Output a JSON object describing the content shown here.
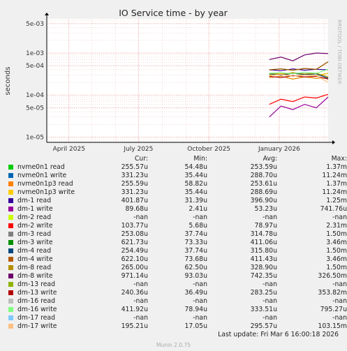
{
  "title": "IO Service time - by year",
  "watermark": "RRDTOOL / TOBI OETIKER",
  "footer": {
    "last_update": "Last update: Fri Mar  6 16:00:18 2026",
    "version": "Munin 2.0.75"
  },
  "legend_headers": {
    "cur": "Cur:",
    "min": "Min:",
    "avg": "Avg:",
    "max": "Max:"
  },
  "legend": [
    {
      "name": "nvme0n1 read",
      "color": "#00cc00",
      "cur": "255.57u",
      "min": "54.48u",
      "avg": "253.59u",
      "max": "1.37m"
    },
    {
      "name": "nvme0n1 write",
      "color": "#0066b3",
      "cur": "331.23u",
      "min": "35.44u",
      "avg": "288.70u",
      "max": "11.24m"
    },
    {
      "name": "nvme0n1p3 read",
      "color": "#ff8000",
      "cur": "255.59u",
      "min": "58.82u",
      "avg": "253.61u",
      "max": "1.37m"
    },
    {
      "name": "nvme0n1p3 write",
      "color": "#ffcc00",
      "cur": "331.23u",
      "min": "35.44u",
      "avg": "288.69u",
      "max": "11.24m"
    },
    {
      "name": "dm-1 read",
      "color": "#330099",
      "cur": "401.87u",
      "min": "31.39u",
      "avg": "396.90u",
      "max": "1.25m"
    },
    {
      "name": "dm-1 write",
      "color": "#990099",
      "cur": "89.68u",
      "min": "2.41u",
      "avg": "53.23u",
      "max": "741.76u"
    },
    {
      "name": "dm-2 read",
      "color": "#ccff00",
      "cur": "-nan",
      "min": "-nan",
      "avg": "-nan",
      "max": "-nan"
    },
    {
      "name": "dm-2 write",
      "color": "#ff0000",
      "cur": "103.77u",
      "min": "5.68u",
      "avg": "78.97u",
      "max": "2.31m"
    },
    {
      "name": "dm-3 read",
      "color": "#808080",
      "cur": "253.08u",
      "min": "37.74u",
      "avg": "314.78u",
      "max": "1.50m"
    },
    {
      "name": "dm-3 write",
      "color": "#008f00",
      "cur": "621.73u",
      "min": "73.33u",
      "avg": "411.06u",
      "max": "3.46m"
    },
    {
      "name": "dm-4 read",
      "color": "#00487d",
      "cur": "254.49u",
      "min": "37.74u",
      "avg": "315.80u",
      "max": "1.50m"
    },
    {
      "name": "dm-4 write",
      "color": "#b35a00",
      "cur": "622.10u",
      "min": "73.68u",
      "avg": "411.43u",
      "max": "3.46m"
    },
    {
      "name": "dm-8 read",
      "color": "#b38f00",
      "cur": "265.00u",
      "min": "62.50u",
      "avg": "328.90u",
      "max": "1.50m"
    },
    {
      "name": "dm-8 write",
      "color": "#6b006b",
      "cur": "971.14u",
      "min": "93.03u",
      "avg": "742.35u",
      "max": "326.50m"
    },
    {
      "name": "dm-13 read",
      "color": "#8fb300",
      "cur": "-nan",
      "min": "-nan",
      "avg": "-nan",
      "max": "-nan"
    },
    {
      "name": "dm-13 write",
      "color": "#b30000",
      "cur": "240.36u",
      "min": "36.49u",
      "avg": "283.25u",
      "max": "353.82m"
    },
    {
      "name": "dm-16 read",
      "color": "#bebebe",
      "cur": "-nan",
      "min": "-nan",
      "avg": "-nan",
      "max": "-nan"
    },
    {
      "name": "dm-16 write",
      "color": "#80ff80",
      "cur": "411.92u",
      "min": "78.94u",
      "avg": "333.51u",
      "max": "795.27u"
    },
    {
      "name": "dm-17 read",
      "color": "#80c9ff",
      "cur": "-nan",
      "min": "-nan",
      "avg": "-nan",
      "max": "-nan"
    },
    {
      "name": "dm-17 write",
      "color": "#ffc080",
      "cur": "195.21u",
      "min": "17.05u",
      "avg": "295.57u",
      "max": "103.15m"
    }
  ],
  "chart_data": {
    "type": "line",
    "title": "IO Service time - by year",
    "ylabel": "seconds",
    "xlabel": "",
    "y_scale": "log",
    "ylim": [
      7.5e-06,
      0.0065
    ],
    "y_ticks": [
      {
        "value": 1e-05,
        "label": "1e-05"
      },
      {
        "value": 5e-05,
        "label": "5e-05"
      },
      {
        "value": 0.0001,
        "label": "1e-04"
      },
      {
        "value": 0.0005,
        "label": "5e-04"
      },
      {
        "value": 0.001,
        "label": "1e-03"
      },
      {
        "value": 0.005,
        "label": "5e-03"
      }
    ],
    "xlim": [
      "2025-03-03",
      "2026-03-06"
    ],
    "x_ticks": [
      {
        "value": "2025-04-01",
        "label": "April 2025"
      },
      {
        "value": "2025-07-01",
        "label": "July 2025"
      },
      {
        "value": "2025-10-01",
        "label": "October 2025"
      },
      {
        "value": "2026-01-01",
        "label": "January 2026"
      }
    ],
    "grid": true,
    "data_start": "2025-12-19",
    "series": [
      {
        "name": "nvme0n1 read",
        "color": "#00cc00",
        "values": [
          0.00026,
          0.00028,
          0.00024,
          0.00027,
          0.00025,
          0.00026
        ]
      },
      {
        "name": "nvme0n1 write",
        "color": "#0066b3",
        "values": [
          0.0003,
          0.00033,
          0.00028,
          0.00031,
          0.00029,
          0.00033
        ]
      },
      {
        "name": "nvme0n1p3 read",
        "color": "#ff8000",
        "values": [
          0.00026,
          0.00028,
          0.00024,
          0.00027,
          0.00025,
          0.00026
        ]
      },
      {
        "name": "nvme0n1p3 write",
        "color": "#ffcc00",
        "values": [
          0.0003,
          0.00033,
          0.00028,
          0.00031,
          0.00029,
          0.00033
        ]
      },
      {
        "name": "dm-1 read",
        "color": "#330099",
        "values": [
          0.0004,
          0.00038,
          0.00042,
          0.00039,
          0.00041,
          0.0004
        ]
      },
      {
        "name": "dm-1 write",
        "color": "#990099",
        "values": [
          3e-05,
          5.5e-05,
          4.5e-05,
          6e-05,
          5e-05,
          9e-05
        ]
      },
      {
        "name": "dm-2 write",
        "color": "#ff0000",
        "values": [
          6e-05,
          8e-05,
          7e-05,
          9e-05,
          8.5e-05,
          0.000104
        ]
      },
      {
        "name": "dm-3 read",
        "color": "#808080",
        "values": [
          0.00032,
          0.0003,
          0.00033,
          0.00031,
          0.00032,
          0.00025
        ]
      },
      {
        "name": "dm-3 write",
        "color": "#008f00",
        "values": [
          0.0004,
          0.00042,
          0.00039,
          0.00043,
          0.00041,
          0.00062
        ]
      },
      {
        "name": "dm-4 read",
        "color": "#00487d",
        "values": [
          0.00032,
          0.0003,
          0.00033,
          0.00031,
          0.00032,
          0.00025
        ]
      },
      {
        "name": "dm-4 write",
        "color": "#b35a00",
        "values": [
          0.0004,
          0.00042,
          0.00039,
          0.00043,
          0.00041,
          0.00062
        ]
      },
      {
        "name": "dm-8 read",
        "color": "#b38f00",
        "values": [
          0.00033,
          0.00031,
          0.00034,
          0.00032,
          0.00033,
          0.00027
        ]
      },
      {
        "name": "dm-8 write",
        "color": "#6b006b",
        "values": [
          0.0007,
          0.0008,
          0.00065,
          0.0009,
          0.001,
          0.00097
        ]
      },
      {
        "name": "dm-13 write",
        "color": "#b30000",
        "values": [
          0.00028,
          0.00026,
          0.00029,
          0.00027,
          0.00028,
          0.00024
        ]
      },
      {
        "name": "dm-16 write",
        "color": "#80ff80",
        "values": [
          0.00033,
          0.00034,
          0.00032,
          0.00035,
          0.00033,
          0.00041
        ]
      },
      {
        "name": "dm-17 write",
        "color": "#ffc080",
        "values": [
          0.00029,
          0.00031,
          0.00028,
          0.0003,
          0.00029,
          0.0002
        ]
      }
    ]
  }
}
